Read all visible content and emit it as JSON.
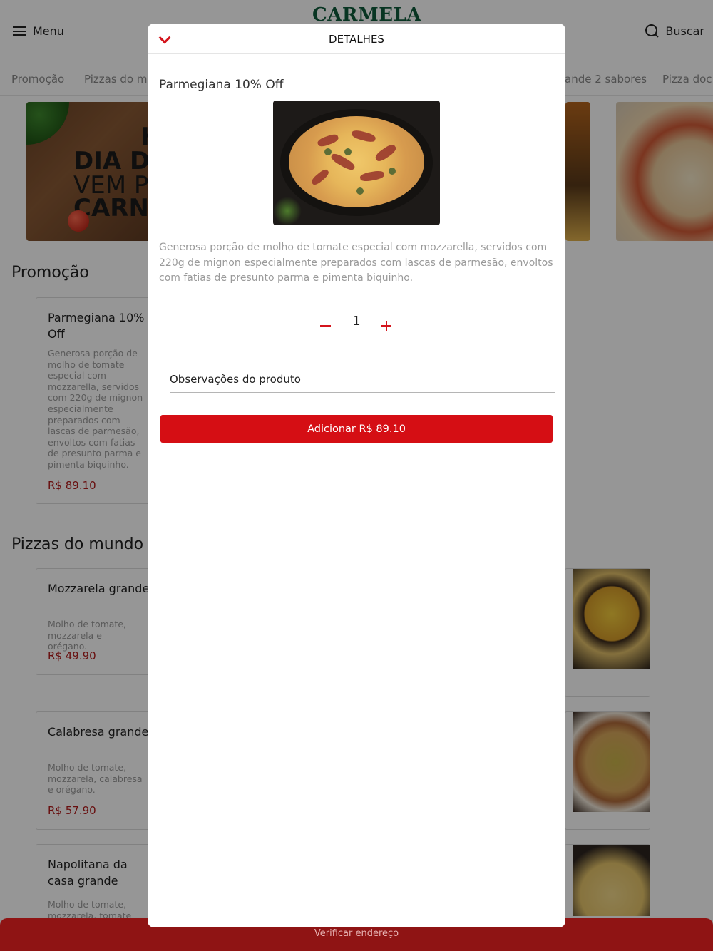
{
  "header": {
    "menu_label": "Menu",
    "logo_text": "CARMELA",
    "search_label": "Buscar"
  },
  "categories": [
    "Promoção",
    "Pizzas do mu",
    "ande 2 sabores",
    "Pizza doc"
  ],
  "banner": {
    "lines": [
      "H",
      "DIA DE",
      "VEM P",
      "CARN"
    ]
  },
  "sections": [
    {
      "title": "Promoção",
      "items": [
        {
          "name": "Parmegiana 10% Off",
          "description": "Generosa porção de molho de tomate especial com mozzarella, servidos com 220g de mignon especialmente preparados com lascas de parmesão, envoltos com fatias de presunto parma e pimenta biquinho.",
          "price": "R$ 89.10"
        }
      ]
    },
    {
      "title": "Pizzas do mundo -",
      "items": [
        {
          "name": "Mozzarela grande",
          "description": "Molho de tomate, mozzarela e orégano.",
          "price": "R$ 49.90"
        },
        {
          "name": "Calabresa grande",
          "description": "Molho de tomate, mozzarela, calabresa e orégano.",
          "price": "R$ 57.90"
        },
        {
          "name": "Napolitana da casa grande",
          "description": "Molho de tomate, mozzarela, tomate",
          "price": ""
        }
      ]
    }
  ],
  "bottom_bar": {
    "label": "Verificar endereço"
  },
  "modal": {
    "title": "DETALHES",
    "product_name": "Parmegiana 10% Off",
    "product_description": "Generosa porção de molho de tomate especial com mozzarella, servidos com 220g de mignon especialmente preparados com lascas de parmesão, envoltos com fatias de presunto parma e pimenta biquinho.",
    "quantity": "1",
    "notes_placeholder": "Observações do produto",
    "add_button_label": "Adicionar R$ 89.10"
  },
  "colors": {
    "accent": "#d50e14",
    "price": "#b21a1a",
    "brand": "#0f5a3a",
    "bottom_bar": "#8f1414"
  },
  "icons": [
    "menu-icon",
    "search-icon",
    "chevron-down-icon",
    "minus-icon",
    "plus-icon"
  ]
}
